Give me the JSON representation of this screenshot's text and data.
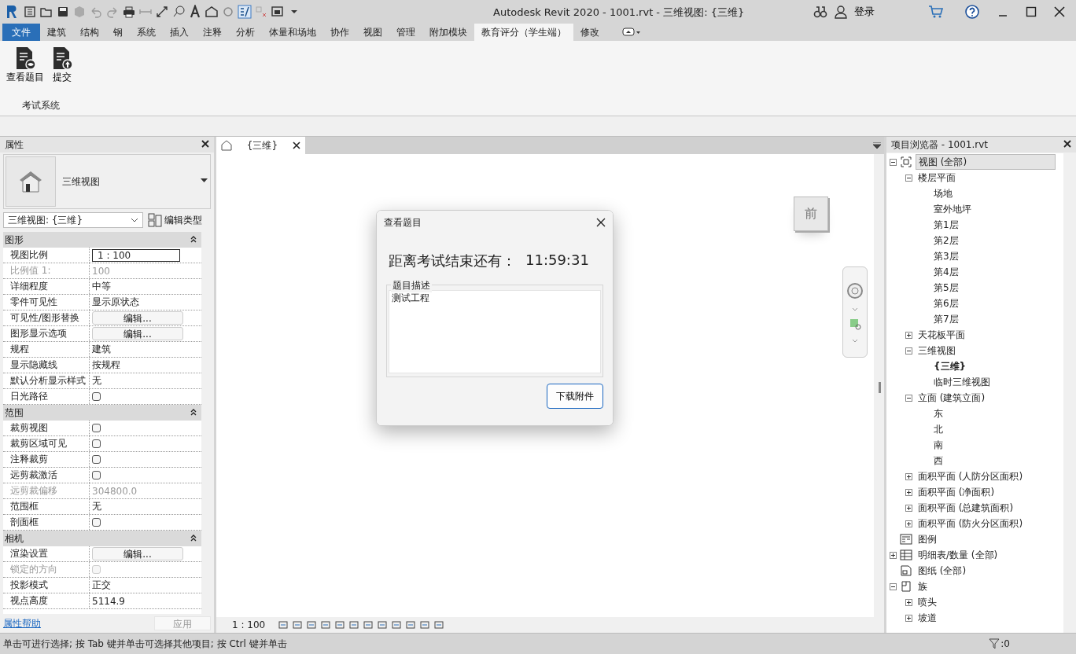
{
  "window": {
    "title": "Autodesk Revit 2020 - 1001.rvt - 三维视图: {三维}",
    "login": "登录"
  },
  "ribbon_tabs": [
    {
      "label": "文件",
      "kind": "file",
      "selected": false
    },
    {
      "label": "建筑",
      "kind": "tab",
      "selected": false
    },
    {
      "label": "结构",
      "kind": "tab",
      "selected": false
    },
    {
      "label": "钢",
      "kind": "tab",
      "selected": false
    },
    {
      "label": "系统",
      "kind": "tab",
      "selected": false
    },
    {
      "label": "插入",
      "kind": "tab",
      "selected": false
    },
    {
      "label": "注释",
      "kind": "tab",
      "selected": false
    },
    {
      "label": "分析",
      "kind": "tab",
      "selected": false
    },
    {
      "label": "体量和场地",
      "kind": "tab",
      "selected": false
    },
    {
      "label": "协作",
      "kind": "tab",
      "selected": false
    },
    {
      "label": "视图",
      "kind": "tab",
      "selected": false
    },
    {
      "label": "管理",
      "kind": "tab",
      "selected": false
    },
    {
      "label": "附加模块",
      "kind": "tab",
      "selected": false
    },
    {
      "label": "教育评分（学生端）",
      "kind": "tab",
      "selected": true
    },
    {
      "label": "修改",
      "kind": "tab",
      "selected": false
    }
  ],
  "ribbon_panel": {
    "title": "考试系统",
    "buttons": [
      {
        "label": "查看题目",
        "kind": "view"
      },
      {
        "label": "提交",
        "kind": "submit"
      }
    ]
  },
  "properties": {
    "title": "属性",
    "type_name": "三维视图",
    "selector": "三维视图: {三维}",
    "edit_type": "编辑类型",
    "groups": [
      {
        "name": "图形",
        "rows": [
          {
            "label": "视图比例",
            "kind": "input",
            "value": "1 : 100",
            "disabled": false
          },
          {
            "label": "比例值 1:",
            "kind": "text",
            "value": "100",
            "disabled": true
          },
          {
            "label": "详细程度",
            "kind": "text",
            "value": "中等",
            "disabled": false
          },
          {
            "label": "零件可见性",
            "kind": "text",
            "value": "显示原状态",
            "disabled": false
          },
          {
            "label": "可见性/图形替换",
            "kind": "button",
            "value": "编辑...",
            "disabled": false
          },
          {
            "label": "图形显示选项",
            "kind": "button",
            "value": "编辑...",
            "disabled": false
          },
          {
            "label": "规程",
            "kind": "text",
            "value": "建筑",
            "disabled": false
          },
          {
            "label": "显示隐藏线",
            "kind": "text",
            "value": "按规程",
            "disabled": false
          },
          {
            "label": "默认分析显示样式",
            "kind": "text",
            "value": "无",
            "disabled": false
          },
          {
            "label": "日光路径",
            "kind": "checkbox",
            "checked": false,
            "disabled": false
          }
        ]
      },
      {
        "name": "范围",
        "rows": [
          {
            "label": "裁剪视图",
            "kind": "checkbox",
            "checked": false,
            "disabled": false
          },
          {
            "label": "裁剪区域可见",
            "kind": "checkbox",
            "checked": false,
            "disabled": false
          },
          {
            "label": "注释裁剪",
            "kind": "checkbox",
            "checked": false,
            "disabled": false
          },
          {
            "label": "远剪裁激活",
            "kind": "checkbox",
            "checked": false,
            "disabled": false
          },
          {
            "label": "远剪裁偏移",
            "kind": "text",
            "value": "304800.0",
            "disabled": true
          },
          {
            "label": "范围框",
            "kind": "text",
            "value": "无",
            "disabled": false
          },
          {
            "label": "剖面框",
            "kind": "checkbox",
            "checked": false,
            "disabled": false
          }
        ]
      },
      {
        "name": "相机",
        "rows": [
          {
            "label": "渲染设置",
            "kind": "button",
            "value": "编辑...",
            "disabled": false
          },
          {
            "label": "锁定的方向",
            "kind": "checkbox",
            "checked": false,
            "disabled": true
          },
          {
            "label": "投影模式",
            "kind": "text",
            "value": "正交",
            "disabled": false
          },
          {
            "label": "视点高度",
            "kind": "text",
            "value": "5114.9",
            "disabled": false
          }
        ]
      }
    ],
    "help_link": "属性帮助",
    "apply": "应用"
  },
  "view": {
    "tab": "{三维}",
    "viewcube_face": "前",
    "scale": "1 : 100"
  },
  "dialog": {
    "title": "查看题目",
    "countdown_label": "距离考试结束还有：",
    "countdown": "11:59:31",
    "group": "题目描述",
    "description": "测试工程",
    "button": "下载附件"
  },
  "browser": {
    "title": "项目浏览器 - 1001.rvt",
    "tree": [
      {
        "label": "视图 (全部)",
        "kind": "views",
        "expanded": true,
        "selected": true,
        "children": [
          {
            "label": "楼层平面",
            "expanded": true,
            "selected": false,
            "children": [
              {
                "label": "场地",
                "selected": false
              },
              {
                "label": "室外地坪",
                "selected": false
              },
              {
                "label": "第1层",
                "selected": false
              },
              {
                "label": "第2层",
                "selected": false
              },
              {
                "label": "第3层",
                "selected": false
              },
              {
                "label": "第4层",
                "selected": false
              },
              {
                "label": "第5层",
                "selected": false
              },
              {
                "label": "第6层",
                "selected": false
              },
              {
                "label": "第7层",
                "selected": false
              }
            ]
          },
          {
            "label": "天花板平面",
            "expanded": false,
            "selected": false
          },
          {
            "label": "三维视图",
            "expanded": true,
            "selected": false,
            "children": [
              {
                "label": "{三维}",
                "selected": false,
                "current": true
              },
              {
                "label": "临时三维视图",
                "selected": false
              }
            ]
          },
          {
            "label": "立面 (建筑立面)",
            "expanded": true,
            "selected": false,
            "children": [
              {
                "label": "东",
                "selected": false
              },
              {
                "label": "北",
                "selected": false
              },
              {
                "label": "南",
                "selected": false
              },
              {
                "label": "西",
                "selected": false
              }
            ]
          },
          {
            "label": "面积平面 (人防分区面积)",
            "expanded": false,
            "selected": false
          },
          {
            "label": "面积平面 (净面积)",
            "expanded": false,
            "selected": false
          },
          {
            "label": "面积平面 (总建筑面积)",
            "expanded": false,
            "selected": false
          },
          {
            "label": "面积平面 (防火分区面积)",
            "expanded": false,
            "selected": false
          }
        ]
      },
      {
        "label": "图例",
        "kind": "legend",
        "selected": false
      },
      {
        "label": "明细表/数量 (全部)",
        "kind": "schedule",
        "expanded": false,
        "selected": false
      },
      {
        "label": "图纸 (全部)",
        "kind": "sheet",
        "selected": false
      },
      {
        "label": "族",
        "kind": "family",
        "expanded": true,
        "selected": false,
        "children": [
          {
            "label": "喷头",
            "expanded": false,
            "selected": false
          },
          {
            "label": "坡道",
            "expanded": false,
            "selected": false
          }
        ]
      }
    ]
  },
  "status_bar": {
    "message": "单击可进行选择; 按 Tab 键并单击可选择其他项目; 按 Ctrl 键并单击",
    "filter_count": ":0"
  }
}
